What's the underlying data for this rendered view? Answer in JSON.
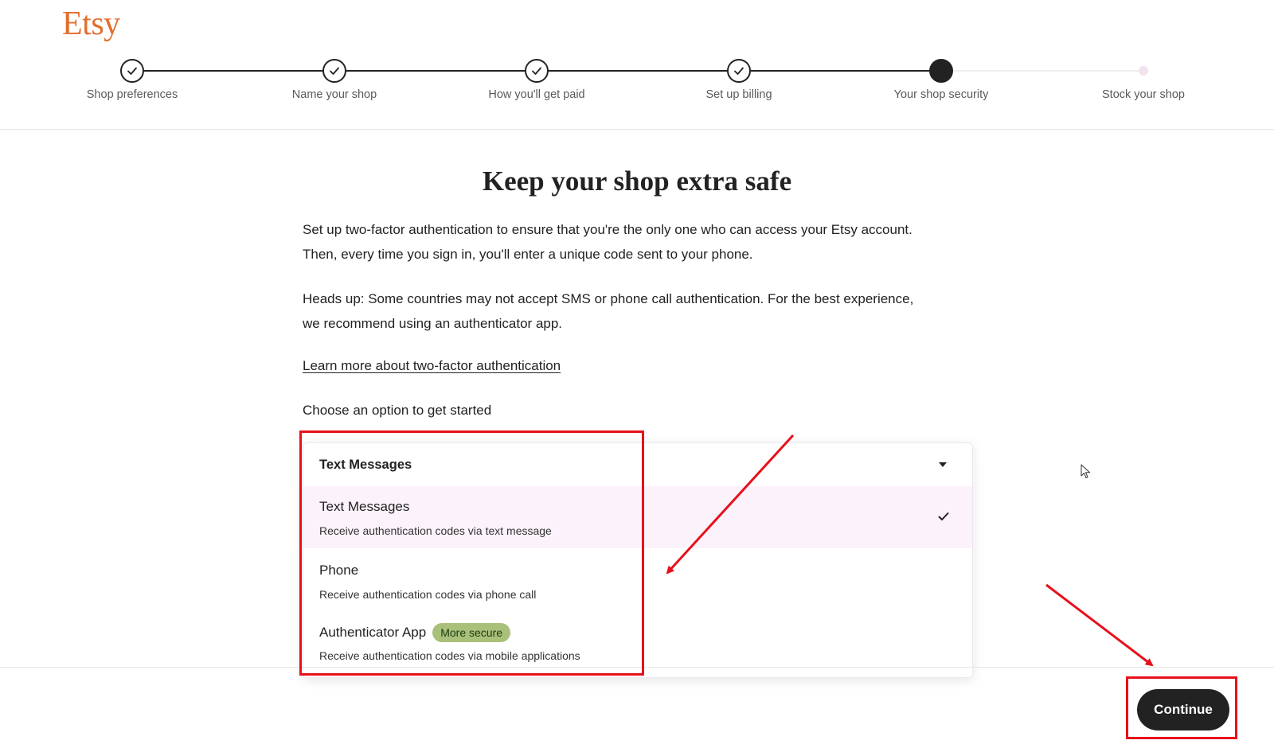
{
  "brand": {
    "logo_text": "Etsy",
    "color": "#e26e2e"
  },
  "stepper": {
    "steps": [
      {
        "label": "Shop preferences",
        "state": "done"
      },
      {
        "label": "Name your shop",
        "state": "done"
      },
      {
        "label": "How you'll get paid",
        "state": "done"
      },
      {
        "label": "Set up billing",
        "state": "done"
      },
      {
        "label": "Your shop security",
        "state": "current"
      },
      {
        "label": "Stock your shop",
        "state": "pending"
      }
    ]
  },
  "main": {
    "title": "Keep your shop extra safe",
    "paragraph1": "Set up two-factor authentication to ensure that you're the only one who can access your Etsy account. Then, every time you sign in, you'll enter a unique code sent to your phone.",
    "paragraph2": "Heads up: Some countries may not accept SMS or phone call authentication. For the best experience, we recommend using an authenticator app.",
    "learn_more_link": "Learn more about two-factor authentication",
    "choose_label": "Choose an option to get started"
  },
  "dropdown": {
    "selected_value": "Text Messages",
    "options": [
      {
        "title": "Text Messages",
        "description": "Receive authentication codes via text message",
        "selected": true
      },
      {
        "title": "Phone",
        "description": "Receive authentication codes via phone call",
        "selected": false
      },
      {
        "title": "Authenticator App",
        "badge": "More secure",
        "description": "Receive authentication codes via mobile applications",
        "selected": false
      }
    ]
  },
  "footer": {
    "continue_label": "Continue"
  },
  "colors": {
    "annotation": "#e8101a",
    "badge_bg": "#a8c07a",
    "selected_bg": "#fcf2fb",
    "primary_button": "#222222"
  }
}
